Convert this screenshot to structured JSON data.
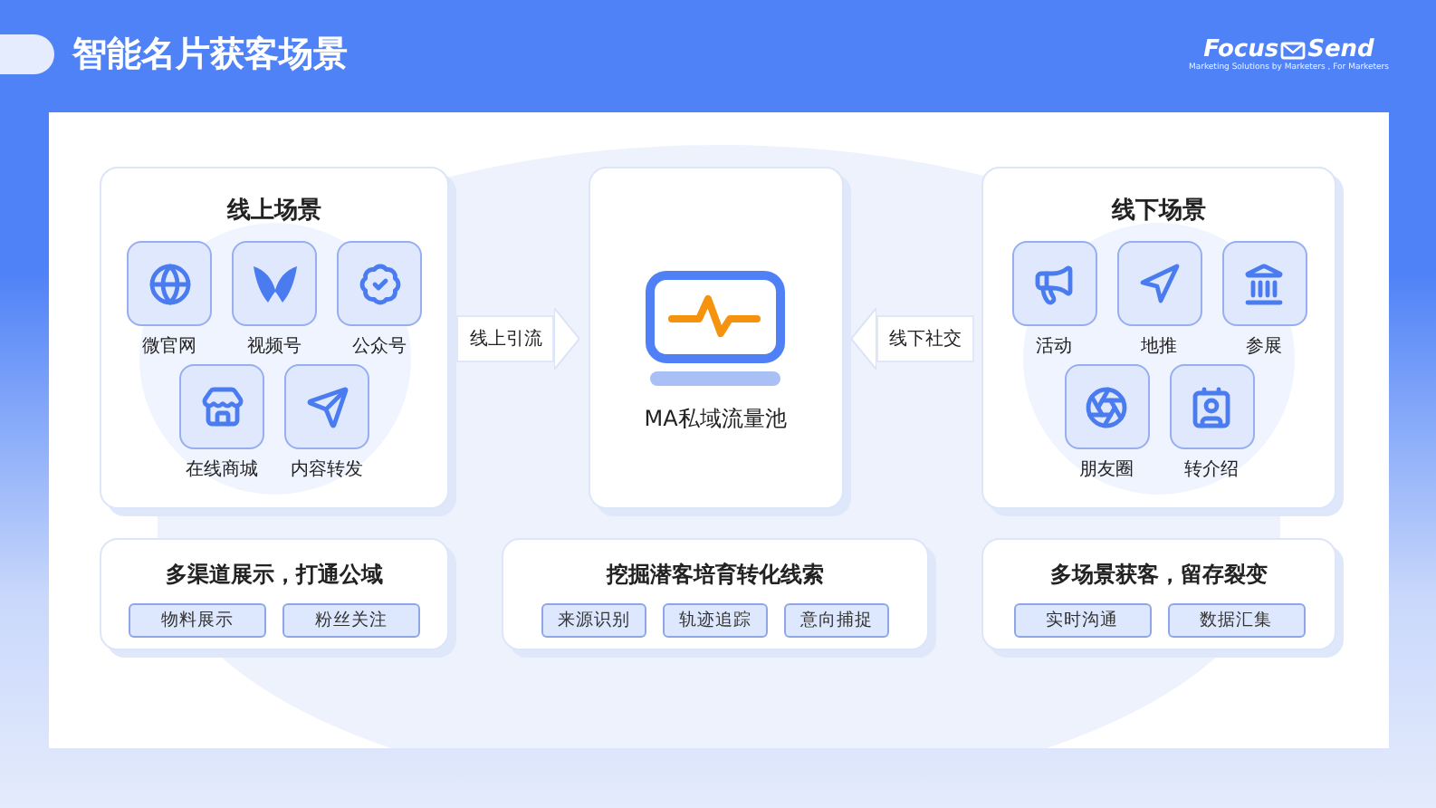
{
  "header": {
    "title": "智能名片获客场景",
    "logo": {
      "brand_left": "Focus",
      "brand_right": "Send",
      "tagline": "Marketing Solutions by Marketers , For Marketers"
    }
  },
  "scenes": [
    {
      "title": "线上场景",
      "items": [
        {
          "label": "微官网"
        },
        {
          "label": "视频号"
        },
        {
          "label": "公众号"
        },
        {
          "label": "在线商城"
        },
        {
          "label": "内容转发"
        }
      ]
    },
    {
      "title": "线下场景",
      "items": [
        {
          "label": "活动"
        },
        {
          "label": "地推"
        },
        {
          "label": "参展"
        },
        {
          "label": "朋友圈"
        },
        {
          "label": "转介绍"
        }
      ]
    }
  ],
  "arrows": [
    {
      "label": "线上引流"
    },
    {
      "label": "线下社交"
    }
  ],
  "hub": {
    "label": "MA私域流量池"
  },
  "features": [
    {
      "title": "多渠道展示，打通公域",
      "tags": [
        "物料展示",
        "粉丝关注"
      ]
    },
    {
      "title": "挖掘潜客培育转化线索",
      "tags": [
        "来源识别",
        "轨迹追踪",
        "意向捕捉"
      ]
    },
    {
      "title": "多场景获客，留存裂变",
      "tags": [
        "实时沟通",
        "数据汇集"
      ]
    }
  ]
}
